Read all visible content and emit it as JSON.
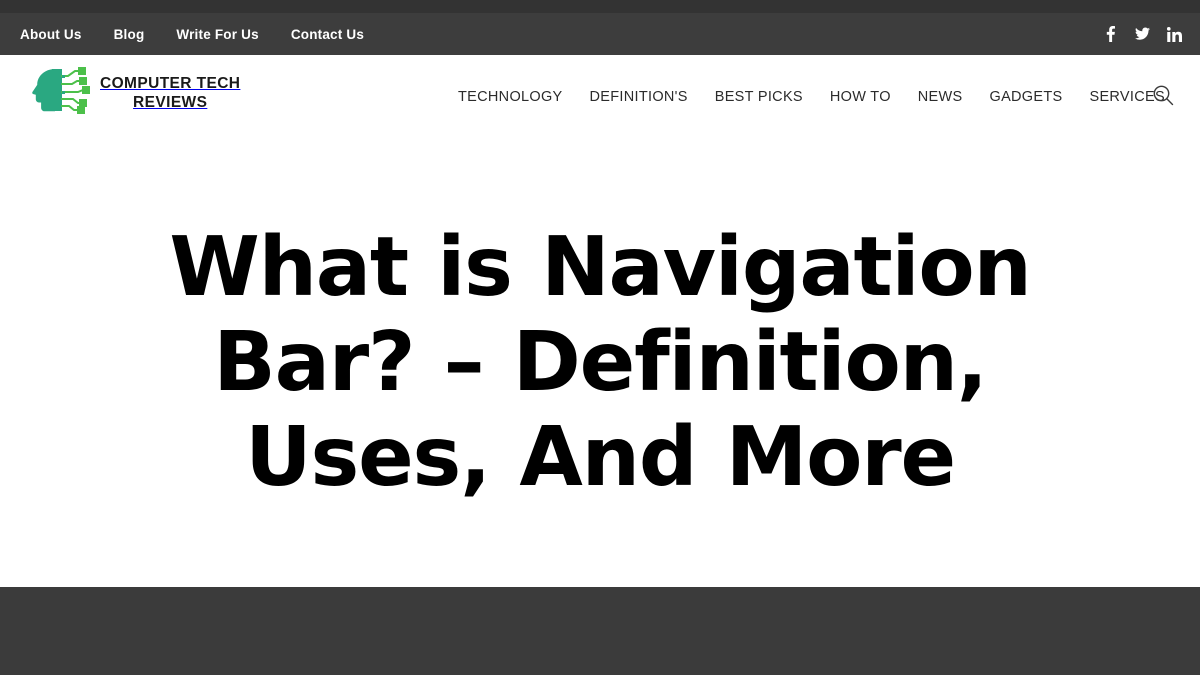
{
  "topbar": {
    "links": [
      {
        "label": "About Us"
      },
      {
        "label": "Blog"
      },
      {
        "label": "Write For Us"
      },
      {
        "label": "Contact Us"
      }
    ],
    "social": [
      {
        "name": "facebook-icon",
        "label": "Facebook"
      },
      {
        "name": "twitter-icon",
        "label": "Twitter"
      },
      {
        "name": "linkedin-icon",
        "label": "LinkedIn"
      }
    ],
    "background_color": "#3d3d3d",
    "text_color": "#ffffff"
  },
  "brand": {
    "line1": "COMPUTER TECH",
    "line2": "REVIEWS",
    "logo_icon": "circuit-head-icon",
    "logo_head_color": "#2aa881",
    "logo_circuit_color": "#4cc04a"
  },
  "nav": {
    "items": [
      {
        "label": "TECHNOLOGY"
      },
      {
        "label": "DEFINITION'S"
      },
      {
        "label": "BEST PICKS"
      },
      {
        "label": "HOW TO"
      },
      {
        "label": "NEWS"
      },
      {
        "label": "GADGETS"
      },
      {
        "label": "SERVICES"
      }
    ],
    "search_icon": "search-icon",
    "text_color": "#2b2b2b"
  },
  "hero": {
    "title": "What is Navigation Bar? – Definition, Uses, And More",
    "title_color": "#000000",
    "background_color": "#ffffff"
  },
  "footer_band": {
    "background_color": "#3b3b3b"
  }
}
